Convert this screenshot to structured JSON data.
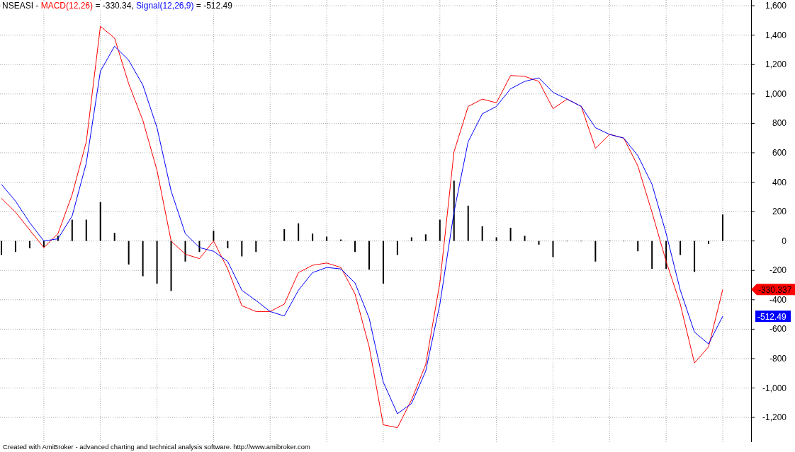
{
  "title": {
    "symbol": "NSEASI - ",
    "macd_reading": " = -330.34, ",
    "signal_reading": " = -512.49"
  },
  "chart_data": {
    "type": "line",
    "grid": true,
    "ylim": [
      -1368,
      1639
    ],
    "yticks": [
      {
        "value": 1600,
        "label": "1,600"
      },
      {
        "value": 1400,
        "label": "1,400"
      },
      {
        "value": 1200,
        "label": "1,200"
      },
      {
        "value": 1000,
        "label": "1,000"
      },
      {
        "value": 800,
        "label": "800"
      },
      {
        "value": 600,
        "label": "600"
      },
      {
        "value": 400,
        "label": "400"
      },
      {
        "value": 200,
        "label": "200"
      },
      {
        "value": 0,
        "label": "0"
      },
      {
        "value": -200,
        "label": "-200"
      },
      {
        "value": -400,
        "label": "-400"
      },
      {
        "value": -600,
        "label": "-600"
      },
      {
        "value": -800,
        "label": "-800"
      },
      {
        "value": -1000,
        "label": "-1,000"
      },
      {
        "value": -1200,
        "label": "-1,200"
      }
    ],
    "series": [
      {
        "name": "MACD(12,26)",
        "color": "#ff0000",
        "values": [
          290,
          195,
          75,
          -45,
          50,
          315,
          675,
          1460,
          1380,
          1070,
          820,
          480,
          0,
          -90,
          -120,
          0,
          -190,
          -440,
          -480,
          -480,
          -430,
          -215,
          -165,
          -150,
          -180,
          -360,
          -720,
          -1250,
          -1270,
          -1080,
          -840,
          -285,
          605,
          915,
          965,
          940,
          1125,
          1120,
          1085,
          900,
          965,
          915,
          630,
          725,
          700,
          510,
          195,
          -140,
          -430,
          -830,
          -720,
          -330
        ]
      },
      {
        "name": "Signal(12,26,9)",
        "color": "#0000ff",
        "values": [
          385,
          270,
          125,
          0,
          15,
          170,
          530,
          1155,
          1325,
          1230,
          1060,
          770,
          340,
          50,
          -45,
          -70,
          -140,
          -335,
          -405,
          -480,
          -510,
          -335,
          -215,
          -180,
          -190,
          -285,
          -525,
          -960,
          -1175,
          -1105,
          -885,
          -430,
          195,
          675,
          865,
          915,
          1035,
          1085,
          1110,
          1010,
          965,
          915,
          770,
          725,
          700,
          580,
          385,
          50,
          -335,
          -620,
          -700,
          -512
        ]
      },
      {
        "type": "bar",
        "color": "#000000",
        "values": [
          -95,
          -75,
          -50,
          -45,
          35,
          145,
          145,
          265,
          55,
          -160,
          -240,
          -290,
          -340,
          -140,
          -75,
          70,
          -50,
          -105,
          -75,
          0,
          80,
          120,
          50,
          30,
          10,
          -75,
          -195,
          -290,
          -95,
          25,
          45,
          145,
          410,
          240,
          100,
          25,
          90,
          35,
          -25,
          -110,
          0,
          0,
          -140,
          0,
          0,
          -70,
          -190,
          -190,
          -95,
          -210,
          -20,
          180
        ]
      }
    ]
  },
  "value_tags": [
    {
      "text": "-330.337",
      "color": "#ff0000"
    },
    {
      "text": "-512.49",
      "color": "#0000ff"
    }
  ],
  "footer": "Created with AmiBroker - advanced charting and technical analysis software. http://www.amibroker.com"
}
